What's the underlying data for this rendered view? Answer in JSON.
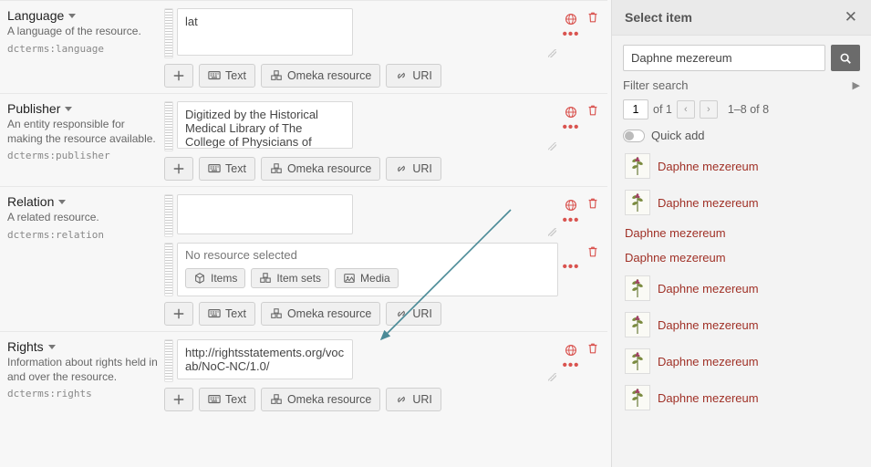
{
  "labels": {
    "text_btn": "Text",
    "omeka_btn": "Omeka resource",
    "uri_btn": "URI",
    "items_btn": "Items",
    "itemsets_btn": "Item sets",
    "media_btn": "Media",
    "no_resource": "No resource selected"
  },
  "props": [
    {
      "name": "Language",
      "desc": "A language of the resource.",
      "term": "dcterms:language",
      "text": "lat"
    },
    {
      "name": "Publisher",
      "desc": "An entity responsible for making the resource available.",
      "term": "dcterms:publisher",
      "text": "Digitized by the Historical Medical Library of The College of Physicians of Philadelphia"
    },
    {
      "name": "Relation",
      "desc": "A related resource.",
      "term": "dcterms:relation",
      "text": ""
    },
    {
      "name": "Rights",
      "desc": "Information about rights held in and over the resource.",
      "term": "dcterms:rights",
      "text": "http://rightsstatements.org/vocab/NoC-NC/1.0/"
    }
  ],
  "panel": {
    "title": "Select item",
    "search_value": "Daphne mezereum",
    "filter_label": "Filter search",
    "page_current": "1",
    "page_of": "of 1",
    "page_range": "1–8 of 8",
    "quick_add": "Quick add",
    "results": [
      {
        "label": "Daphne mezereum",
        "thumb": true
      },
      {
        "label": "Daphne mezereum",
        "thumb": true
      },
      {
        "label": "Daphne mezereum",
        "thumb": false
      },
      {
        "label": "Daphne mezereum",
        "thumb": false
      },
      {
        "label": "Daphne mezereum",
        "thumb": true
      },
      {
        "label": "Daphne mezereum",
        "thumb": true
      },
      {
        "label": "Daphne mezereum",
        "thumb": true
      },
      {
        "label": "Daphne mezereum",
        "thumb": true
      }
    ]
  }
}
